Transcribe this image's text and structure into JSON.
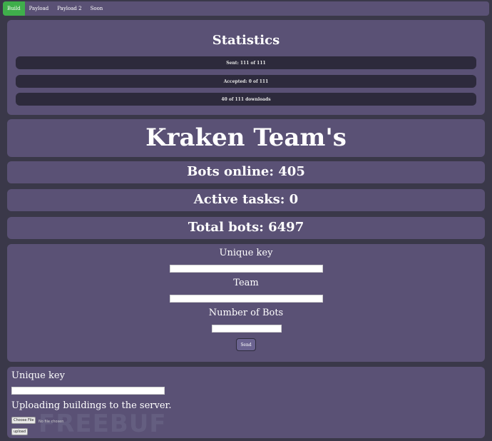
{
  "nav": {
    "items": [
      {
        "label": "Build"
      },
      {
        "label": "Payload"
      },
      {
        "label": "Payload 2"
      },
      {
        "label": "Soon"
      }
    ]
  },
  "stats": {
    "title": "Statistics",
    "sent": "Sent: 111 of 111",
    "accepted": "Accepted: 0 of 111",
    "downloads": "40 of 111 downloads"
  },
  "header": {
    "title": "Kraken Team's"
  },
  "metrics": {
    "bots_online": "Bots online: 405",
    "active_tasks": "Active tasks: 0",
    "total_bots": "Total bots: 6497"
  },
  "form": {
    "unique_key_label": "Unique key",
    "team_label": "Team",
    "bots_label": "Number of Bots",
    "send_label": "Send"
  },
  "upload": {
    "unique_key_label": "Unique key",
    "description": "Uploading buildings to the server.",
    "choose_file_label": "Choose File",
    "no_file_text": "No file chosen",
    "upload_label": "upload"
  },
  "watermark": "FREEBUF",
  "colors": {
    "background": "#3a3849",
    "panel": "#5a5175",
    "stat_bar": "#2d2a3c",
    "nav_active": "#3fae4b"
  }
}
